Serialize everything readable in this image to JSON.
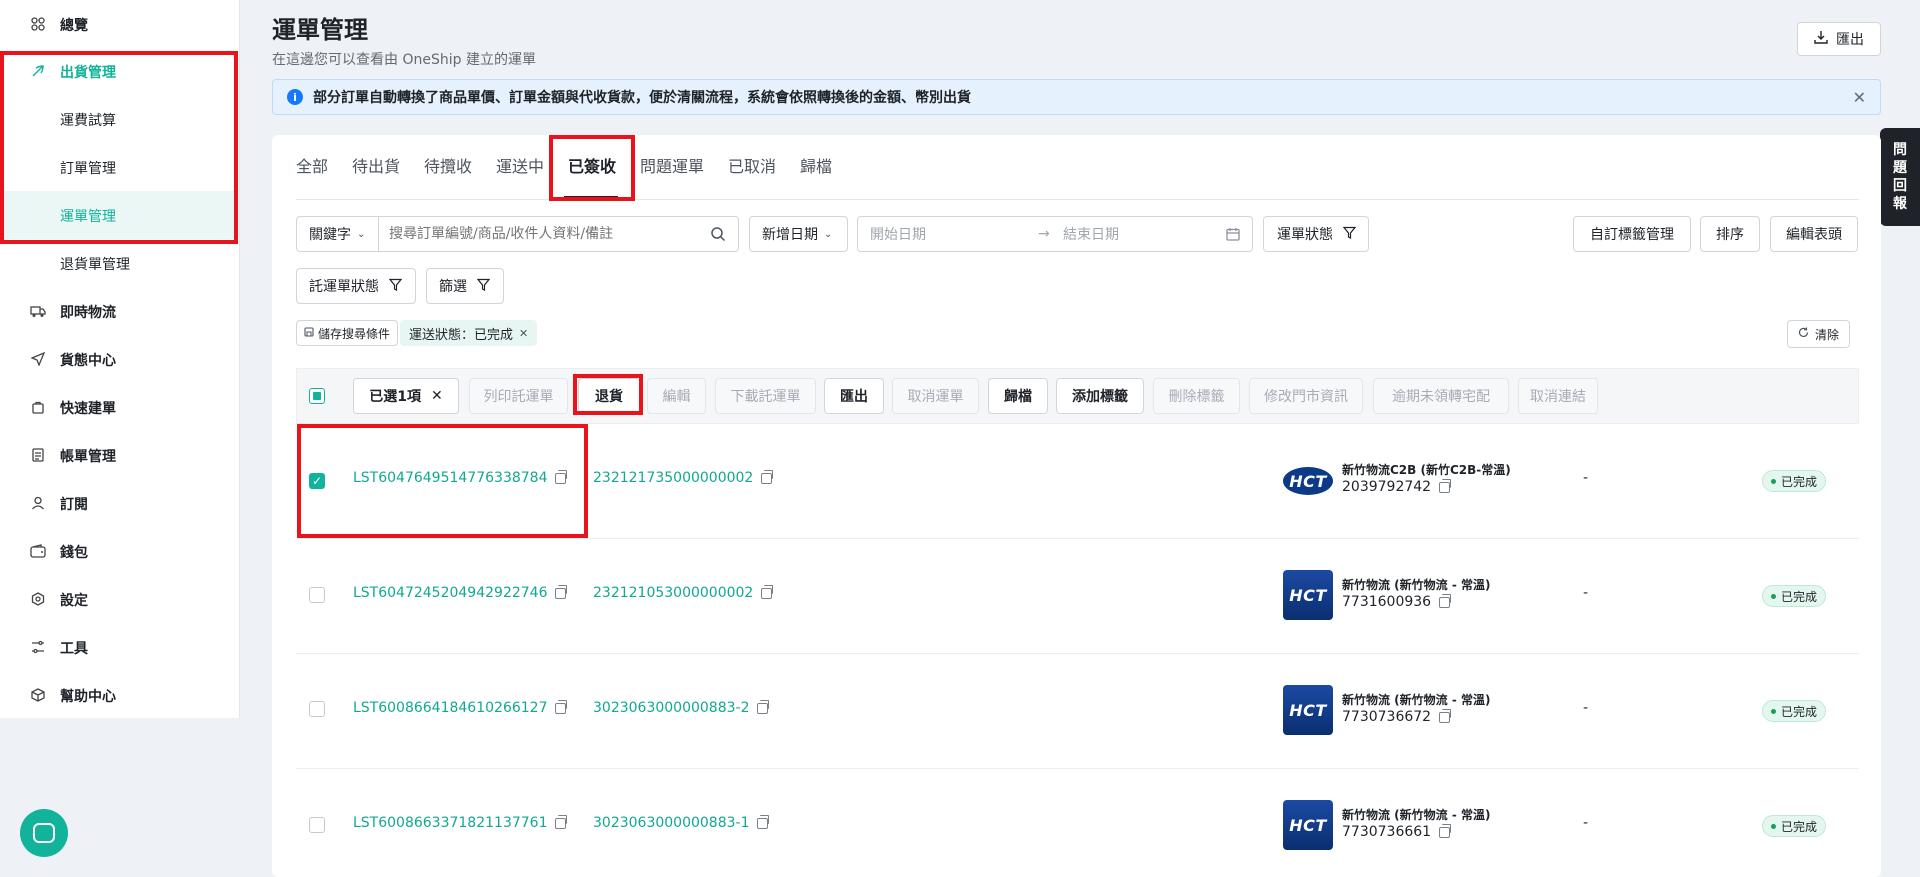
{
  "sidebar": {
    "items": [
      {
        "label": "總覽",
        "icon": "grid-icon"
      },
      {
        "label": "出貨管理",
        "icon": "leaf-icon"
      },
      {
        "label": "運費試算"
      },
      {
        "label": "訂單管理"
      },
      {
        "label": "運單管理"
      },
      {
        "label": "退貨單管理"
      },
      {
        "label": "即時物流",
        "icon": "truck-icon"
      },
      {
        "label": "貨態中心",
        "icon": "send-icon"
      },
      {
        "label": "快速建單",
        "icon": "bag-icon"
      },
      {
        "label": "帳單管理",
        "icon": "document-icon"
      },
      {
        "label": "訂閱",
        "icon": "user-icon"
      },
      {
        "label": "錢包",
        "icon": "wallet-icon"
      },
      {
        "label": "設定",
        "icon": "gear-icon"
      },
      {
        "label": "工具",
        "icon": "tools-icon"
      },
      {
        "label": "幫助中心",
        "icon": "cube-icon"
      }
    ]
  },
  "header": {
    "title": "運單管理",
    "subtitle": "在這邊您可以查看由 OneShip 建立的運單",
    "export_label": "匯出"
  },
  "banner": {
    "text": "部分訂單自動轉換了商品單價、訂單金額與代收貨款，便於清關流程，系統會依照轉換後的金額、幣別出貨"
  },
  "feedback": {
    "chars": [
      "問",
      "題",
      "回",
      "報"
    ]
  },
  "tabs": [
    "全部",
    "待出貨",
    "待攬收",
    "運送中",
    "已簽收",
    "問題運單",
    "已取消",
    "歸檔"
  ],
  "filters": {
    "keyword_label": "關鍵字",
    "search_placeholder": "搜尋訂單編號/商品/收件人資料/備註",
    "date_type": "新增日期",
    "start_date": "開始日期",
    "end_date": "結束日期",
    "shipment_status": "運單狀態",
    "consignment_status": "託運單狀態",
    "filter_label": "篩選",
    "custom_tag_mgmt": "自訂標籤管理",
    "sort": "排序",
    "edit_header": "編輯表頭",
    "save_search": "儲存搜尋條件",
    "active_tag": "運送狀態：已完成",
    "clear": "清除"
  },
  "actions": {
    "selected": "已選1項",
    "print": "列印託運單",
    "return": "退貨",
    "edit": "編輯",
    "download": "下載託運單",
    "export": "匯出",
    "cancel": "取消運單",
    "archive": "歸檔",
    "add_tag": "添加標籤",
    "remove_tag": "刪除標籤",
    "edit_store": "修改門市資訊",
    "overdue": "逾期未領轉宅配",
    "cancel_link": "取消連結"
  },
  "rows": [
    {
      "shipment_id": "LST6047649514776338784",
      "order_id": "232121735000000002",
      "carrier": "新竹物流C2B (新竹C2B-常溫)",
      "tracking": "2039792742",
      "dash": "-",
      "status": "已完成",
      "checked": true
    },
    {
      "shipment_id": "LST6047245204942922746",
      "order_id": "232121053000000002",
      "carrier": "新竹物流 (新竹物流 - 常溫)",
      "tracking": "7731600936",
      "dash": "-",
      "status": "已完成",
      "checked": false
    },
    {
      "shipment_id": "LST6008664184610266127",
      "order_id": "3023063000000883-2",
      "carrier": "新竹物流 (新竹物流 - 常溫)",
      "tracking": "7730736672",
      "dash": "-",
      "status": "已完成",
      "checked": false
    },
    {
      "shipment_id": "LST6008663371821137761",
      "order_id": "3023063000000883-1",
      "carrier": "新竹物流 (新竹物流 - 常溫)",
      "tracking": "7730736661",
      "dash": "-",
      "status": "已完成",
      "checked": false
    }
  ],
  "carrier_logo_text": "HCT",
  "colors": {
    "accent": "#11b39a",
    "highlight": "#e8131b",
    "banner_bg": "#e6f1fe"
  }
}
